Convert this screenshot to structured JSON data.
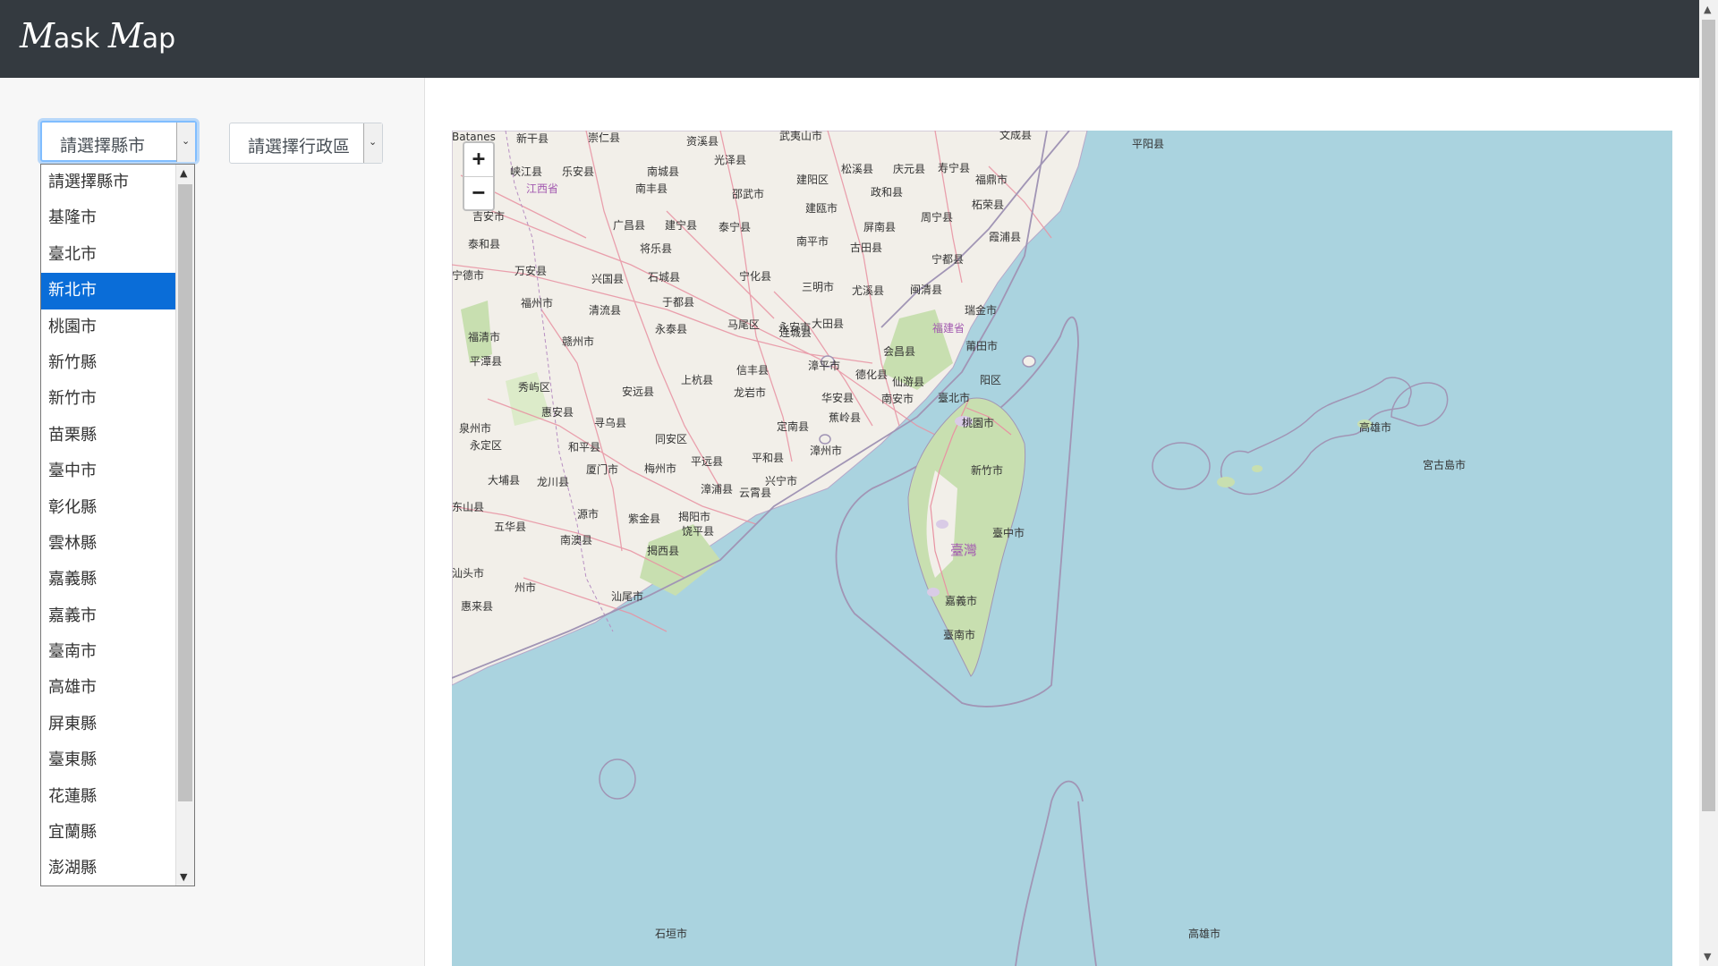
{
  "app": {
    "brand_big_m1": "M",
    "brand_small1": "ask ",
    "brand_big_m2": "M",
    "brand_small2": "ap"
  },
  "selects": {
    "county": {
      "current": "請選擇縣市"
    },
    "district": {
      "current": "請選擇行政區"
    }
  },
  "dropdown": {
    "options": [
      "請選擇縣市",
      "基隆市",
      "臺北市",
      "新北市",
      "桃園市",
      "新竹縣",
      "新竹市",
      "苗栗縣",
      "臺中市",
      "彰化縣",
      "雲林縣",
      "嘉義縣",
      "嘉義市",
      "臺南市",
      "高雄市",
      "屏東縣",
      "臺東縣",
      "花蓮縣",
      "宜蘭縣",
      "澎湖縣"
    ],
    "highlighted": "新北市"
  },
  "map": {
    "zoom_in": "+",
    "zoom_out": "−",
    "labels": [
      {
        "t": "新干县"
      },
      {
        "t": "崇仁县"
      },
      {
        "t": "资溪县"
      },
      {
        "t": "武夷山市"
      },
      {
        "t": "文成县"
      },
      {
        "t": "平阳县"
      },
      {
        "t": "光泽县"
      },
      {
        "t": "峡江县"
      },
      {
        "t": "乐安县"
      },
      {
        "t": "南城县"
      },
      {
        "t": "松溪县"
      },
      {
        "t": "庆元县"
      },
      {
        "t": "寿宁县"
      },
      {
        "t": "江西省"
      },
      {
        "t": "建阳区"
      },
      {
        "t": "福鼎市"
      },
      {
        "t": "南丰县"
      },
      {
        "t": "邵武市"
      },
      {
        "t": "政和县"
      },
      {
        "t": "柘荣县"
      },
      {
        "t": "吉安市"
      },
      {
        "t": "建瓯市"
      },
      {
        "t": "周宁县"
      },
      {
        "t": "广昌县"
      },
      {
        "t": "建宁县"
      },
      {
        "t": "泰宁县"
      },
      {
        "t": "屏南县"
      },
      {
        "t": "泰和县"
      },
      {
        "t": "霞浦县"
      },
      {
        "t": "南平市"
      },
      {
        "t": "古田县"
      },
      {
        "t": "将乐县"
      },
      {
        "t": "宁都县"
      },
      {
        "t": "宁德市"
      },
      {
        "t": "万安县"
      },
      {
        "t": "兴国县"
      },
      {
        "t": "石城县"
      },
      {
        "t": "宁化县"
      },
      {
        "t": "三明市"
      },
      {
        "t": "尤溪县"
      },
      {
        "t": "闽清县"
      },
      {
        "t": "福州市"
      },
      {
        "t": "于都县"
      },
      {
        "t": "清流县"
      },
      {
        "t": "瑞金市"
      },
      {
        "t": "马尾区"
      },
      {
        "t": "永泰县"
      },
      {
        "t": "连城县"
      },
      {
        "t": "永安市"
      },
      {
        "t": "大田县"
      },
      {
        "t": "福建省"
      },
      {
        "t": "福清市"
      },
      {
        "t": "赣州市"
      },
      {
        "t": "会昌县"
      },
      {
        "t": "莆田市"
      },
      {
        "t": "平潭县"
      },
      {
        "t": "信丰县"
      },
      {
        "t": "漳平市"
      },
      {
        "t": "德化县"
      },
      {
        "t": "仙游县"
      },
      {
        "t": "秀屿区"
      },
      {
        "t": "安远县"
      },
      {
        "t": "上杭县"
      },
      {
        "t": "龙岩市"
      },
      {
        "t": "华安县"
      },
      {
        "t": "南安市"
      },
      {
        "t": "惠安县"
      },
      {
        "t": "寻乌县"
      },
      {
        "t": "蕉岭县"
      },
      {
        "t": "泉州市"
      },
      {
        "t": "定南县"
      },
      {
        "t": "同安区"
      },
      {
        "t": "永定区"
      },
      {
        "t": "和平县"
      },
      {
        "t": "平远县"
      },
      {
        "t": "平和县"
      },
      {
        "t": "漳州市"
      },
      {
        "t": "厦门市"
      },
      {
        "t": "梅州市"
      },
      {
        "t": "大埔县"
      },
      {
        "t": "龙川县"
      },
      {
        "t": "兴宁市"
      },
      {
        "t": "漳浦县"
      },
      {
        "t": "云霄县"
      },
      {
        "t": "东山县"
      },
      {
        "t": "源市"
      },
      {
        "t": "五华县"
      },
      {
        "t": "紫金县"
      },
      {
        "t": "揭阳市"
      },
      {
        "t": "饶平县"
      },
      {
        "t": "南澳县"
      },
      {
        "t": "揭西县"
      },
      {
        "t": "汕头市"
      },
      {
        "t": "州市"
      },
      {
        "t": "汕尾市"
      },
      {
        "t": "惠来县"
      },
      {
        "t": "阳区"
      },
      {
        "t": "臺北市"
      },
      {
        "t": "桃園市"
      },
      {
        "t": "新竹市"
      },
      {
        "t": "臺中市"
      },
      {
        "t": "臺灣"
      },
      {
        "t": "嘉義市"
      },
      {
        "t": "臺南市"
      },
      {
        "t": "高雄市"
      },
      {
        "t": "宮古島市"
      },
      {
        "t": "石垣市"
      },
      {
        "t": "高雄市"
      },
      {
        "t": "Batanes"
      }
    ]
  }
}
